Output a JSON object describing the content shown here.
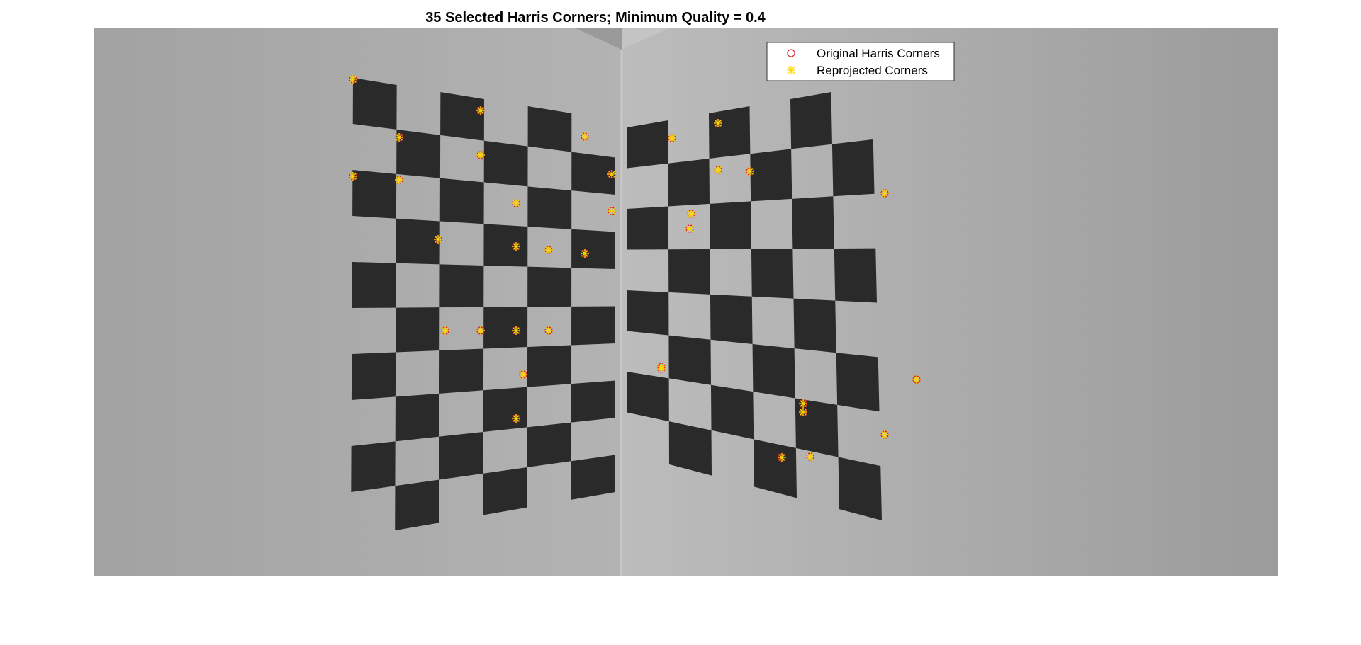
{
  "chart_data": {
    "type": "scatter",
    "title": "35 Selected Harris Corners; Minimum Quality = 0.4",
    "xlabel": "",
    "ylabel": "",
    "image_size": [
      1671,
      773
    ],
    "axis_visible": false,
    "grid": false,
    "legend_placement": "top-right",
    "legend": [
      {
        "label": "Original Harris Corners",
        "marker": "circle",
        "color": "#d62728"
      },
      {
        "label": "Reprojected Corners",
        "marker": "asterisk",
        "color": "#ffd700"
      }
    ],
    "series": [
      {
        "name": "Original Harris Corners",
        "marker": "circle",
        "color": "#d62728",
        "x": [
          366,
          431,
          546,
          693,
          431,
          366,
          546,
          731,
          486,
          596,
          731,
          642,
          693,
          596,
          496,
          546,
          596,
          642,
          606,
          596,
          816,
          881,
          881,
          843,
          926,
          841,
          801,
          1116,
          1001,
          1116,
          1001,
          971,
          801,
          1011,
          1161
        ],
        "y": [
          72,
          154,
          116,
          153,
          214,
          209,
          179,
          206,
          298,
          247,
          258,
          313,
          318,
          308,
          427,
          427,
          427,
          427,
          489,
          551,
          155,
          134,
          200,
          262,
          202,
          283,
          481,
          233,
          530,
          574,
          542,
          606,
          478,
          605,
          496
        ]
      },
      {
        "name": "Reprojected Corners",
        "marker": "asterisk",
        "color": "#ffd700",
        "x": [
          366,
          431,
          546,
          693,
          431,
          366,
          546,
          731,
          486,
          596,
          731,
          642,
          693,
          596,
          496,
          546,
          596,
          642,
          606,
          596,
          816,
          881,
          881,
          843,
          926,
          841,
          801,
          1116,
          1001,
          1116,
          1001,
          971,
          801,
          1011,
          1161
        ],
        "y": [
          72,
          154,
          116,
          153,
          214,
          209,
          179,
          206,
          298,
          247,
          258,
          313,
          318,
          308,
          427,
          427,
          427,
          427,
          489,
          551,
          155,
          134,
          200,
          262,
          202,
          283,
          481,
          233,
          530,
          574,
          542,
          606,
          478,
          605,
          496
        ]
      }
    ]
  }
}
